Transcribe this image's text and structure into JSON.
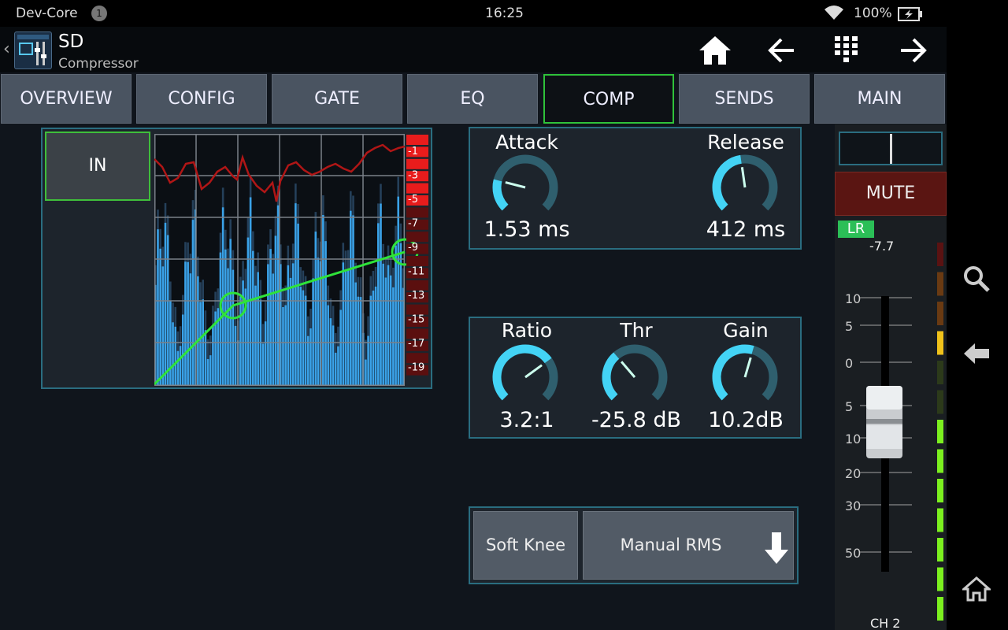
{
  "status_bar": {
    "carrier": "Dev-Core",
    "notification_count": "1",
    "time": "16:25",
    "battery": "100%",
    "icons": [
      "wifi-icon",
      "battery-charging-icon"
    ]
  },
  "header": {
    "title": "SD",
    "subtitle": "Compressor",
    "nav_icons": [
      "home-icon",
      "arrow-left-icon",
      "keypad-icon",
      "arrow-right-icon"
    ]
  },
  "tabs": [
    {
      "label": "OVERVIEW",
      "active": false
    },
    {
      "label": "CONFIG",
      "active": false
    },
    {
      "label": "GATE",
      "active": false
    },
    {
      "label": "EQ",
      "active": false
    },
    {
      "label": "COMP",
      "active": true
    },
    {
      "label": "SENDS",
      "active": false
    },
    {
      "label": "MAIN",
      "active": false
    }
  ],
  "compressor": {
    "in_button": "IN",
    "gain_reduction_scale": [
      "-1",
      "-3",
      "-5",
      "-7",
      "-9",
      "-11",
      "-13",
      "-15",
      "-17",
      "-19"
    ],
    "knobs": {
      "attack": {
        "label": "Attack",
        "value": "1.53 ms",
        "position": 0.22
      },
      "release": {
        "label": "Release",
        "value": "412 ms",
        "position": 0.47
      },
      "ratio": {
        "label": "Ratio",
        "value": "3.2:1",
        "position": 0.7
      },
      "threshold": {
        "label": "Thr",
        "value": "-25.8 dB",
        "position": 0.35
      },
      "gain": {
        "label": "Gain",
        "value": "10.2dB",
        "position": 0.56
      }
    },
    "knee_button": "Soft Knee",
    "detector_select": "Manual RMS",
    "select_icon": "arrow-down-icon"
  },
  "channel_strip": {
    "mute_label": "MUTE",
    "bus_badge": "LR",
    "fader_value": "-7.7",
    "fader_scale": [
      "10",
      "5",
      "0",
      "5",
      "10",
      "20",
      "30",
      "50"
    ],
    "channel_name": "CH 2"
  },
  "android_nav": [
    "search-icon",
    "back-icon",
    "home-icon"
  ],
  "colors": {
    "active_tab_border": "#2fc23a",
    "panel_border": "#2a6d80",
    "knob_accent": "#43d3f5",
    "mute_bg": "#5a1512",
    "meter_red": "#e81c1c"
  }
}
